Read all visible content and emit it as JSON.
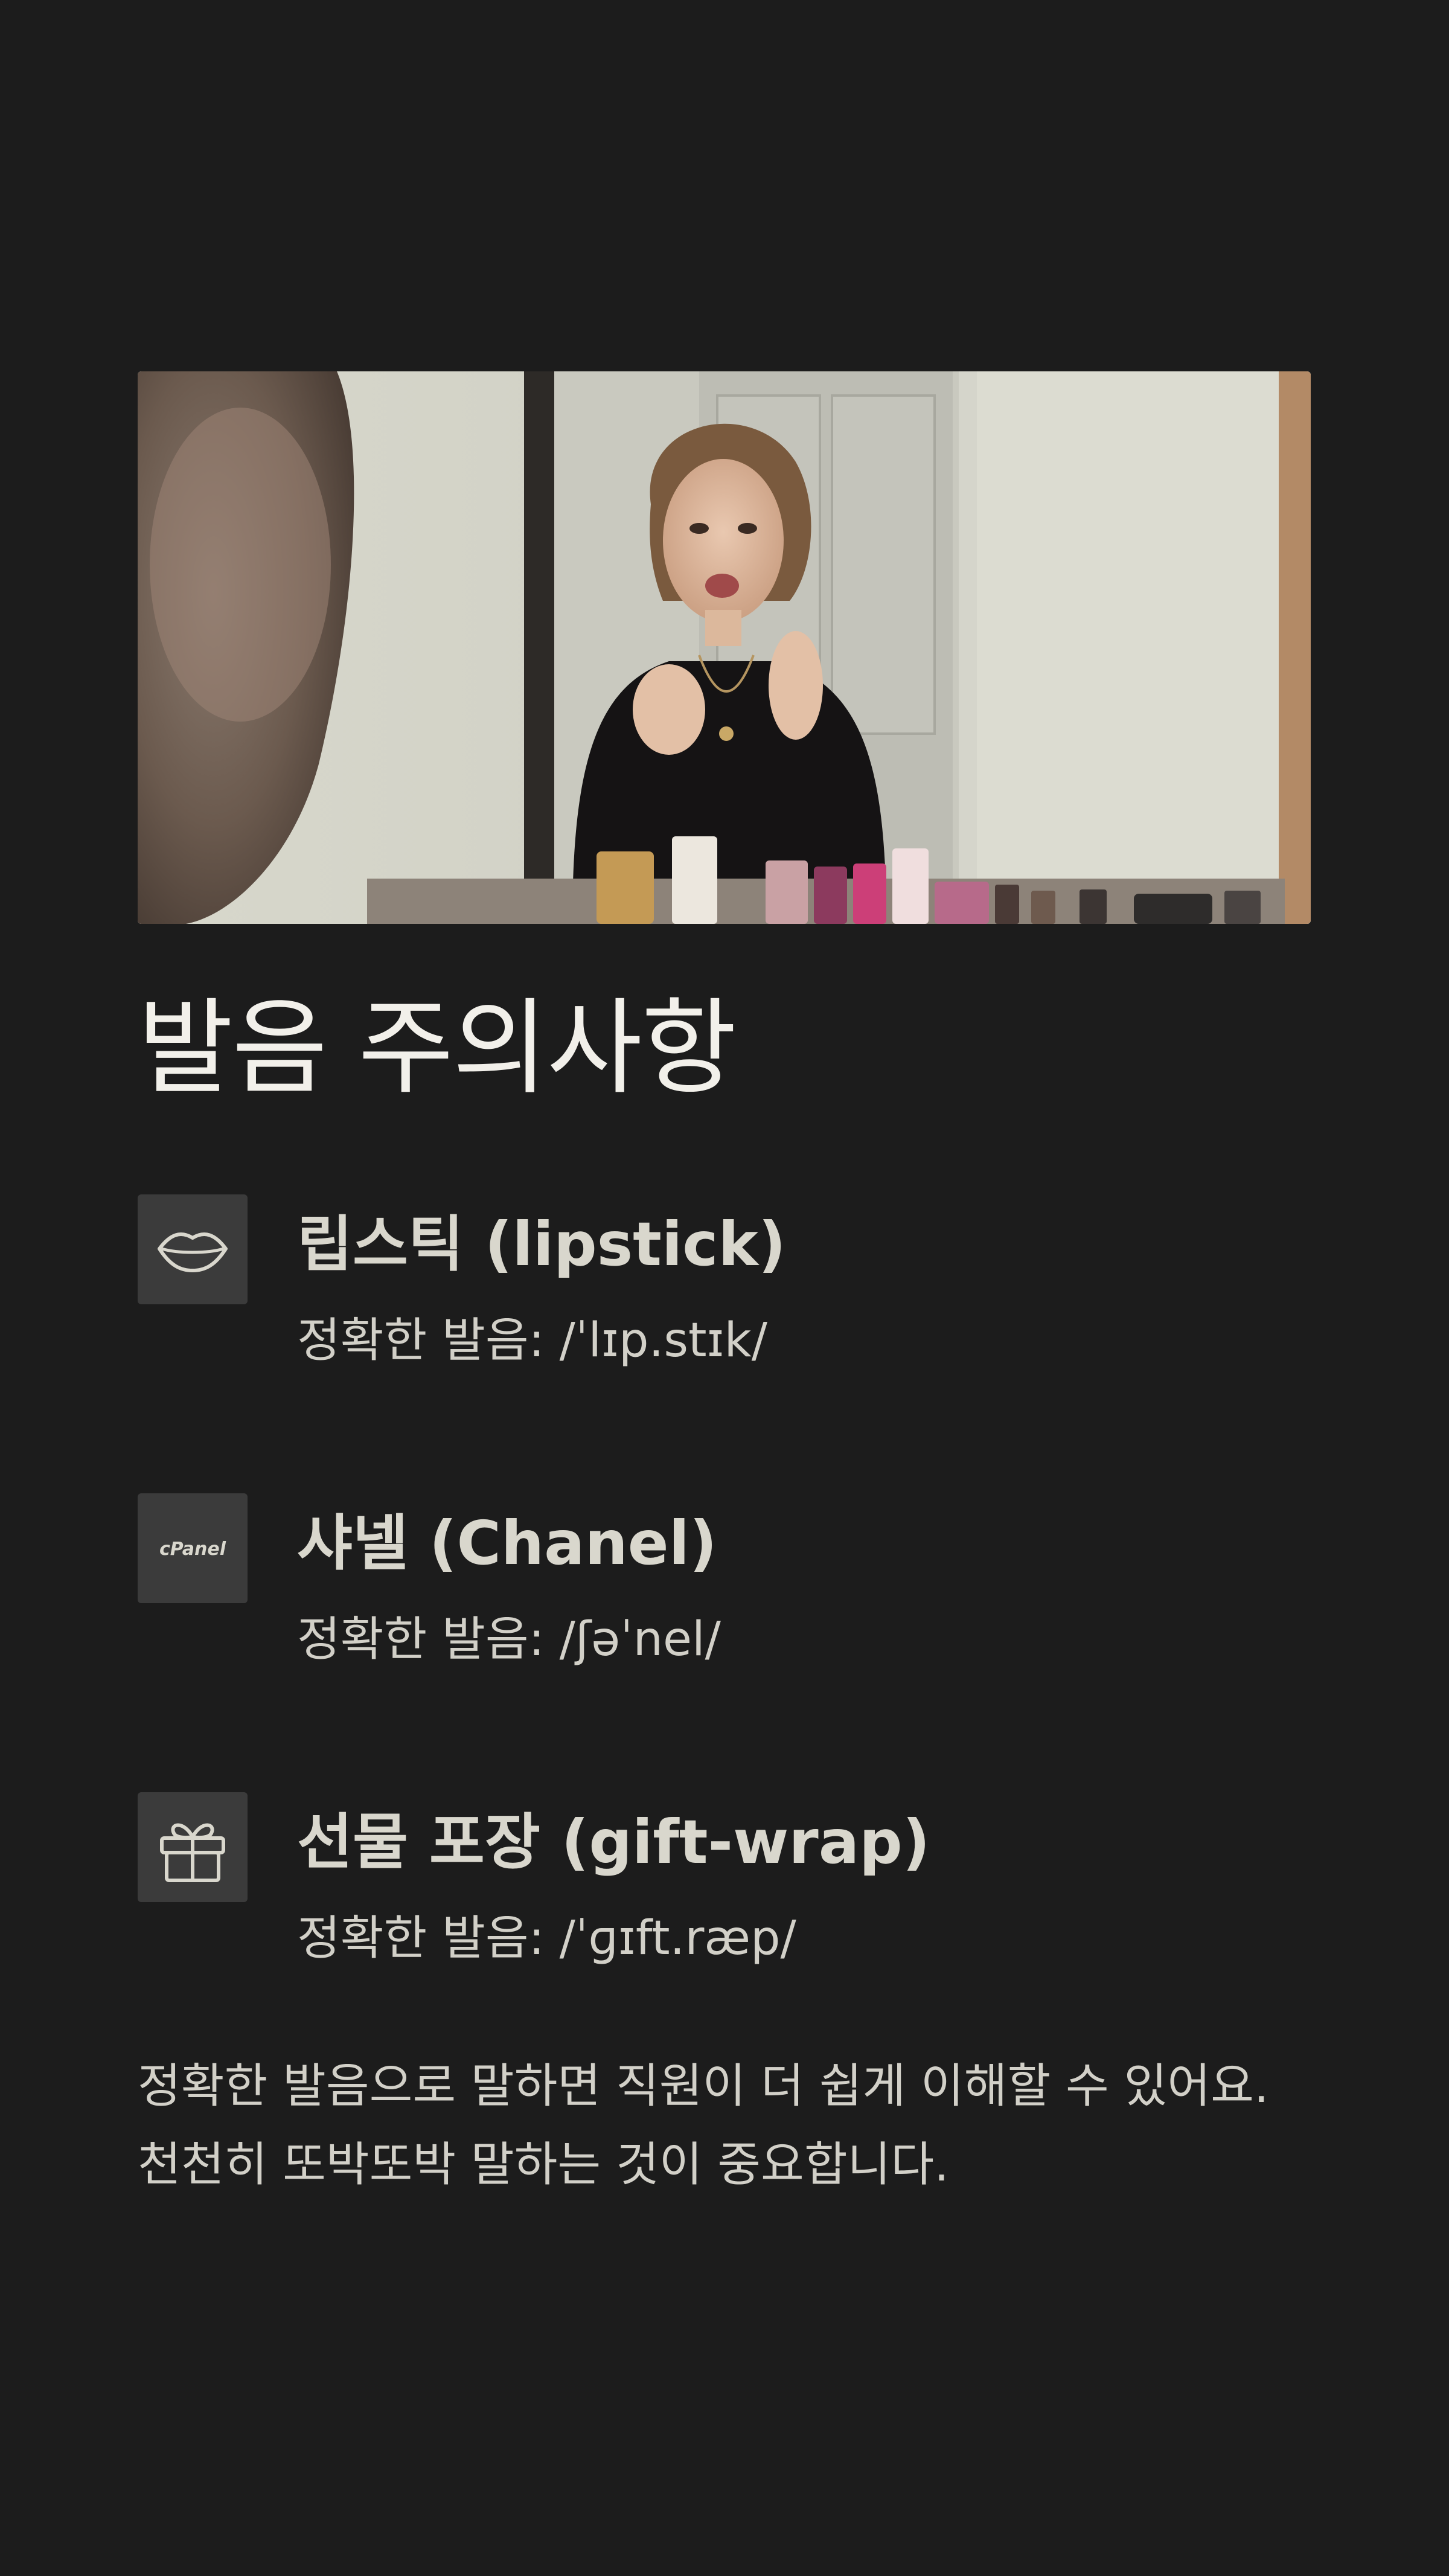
{
  "title": "발음 주의사항",
  "items": [
    {
      "icon": "lips-icon",
      "name": "립스틱 (lipstick)",
      "pronunciation": "정확한 발음: /ˈlɪp.stɪk/"
    },
    {
      "icon": "cpanel-logo-icon",
      "logo_text": "cPanel",
      "name": "샤넬 (Chanel)",
      "pronunciation": "정확한 발음: /ʃəˈnel/"
    },
    {
      "icon": "gift-icon",
      "name": "선물 포장 (gift-wrap)",
      "pronunciation": "정확한 발음: /ˈɡɪft.ræp/"
    }
  ],
  "footer": {
    "line1": "정확한 발음으로 말하면 직원이 더 쉽게 이해할 수 있어요.",
    "line2": "천천히 또박또박 말하는 것이 중요합니다."
  },
  "colors": {
    "background": "#1c1c1c",
    "icon_tile": "#3b3b3b",
    "title_text": "#f2f0ea",
    "body_text": "#d2d0c8"
  }
}
